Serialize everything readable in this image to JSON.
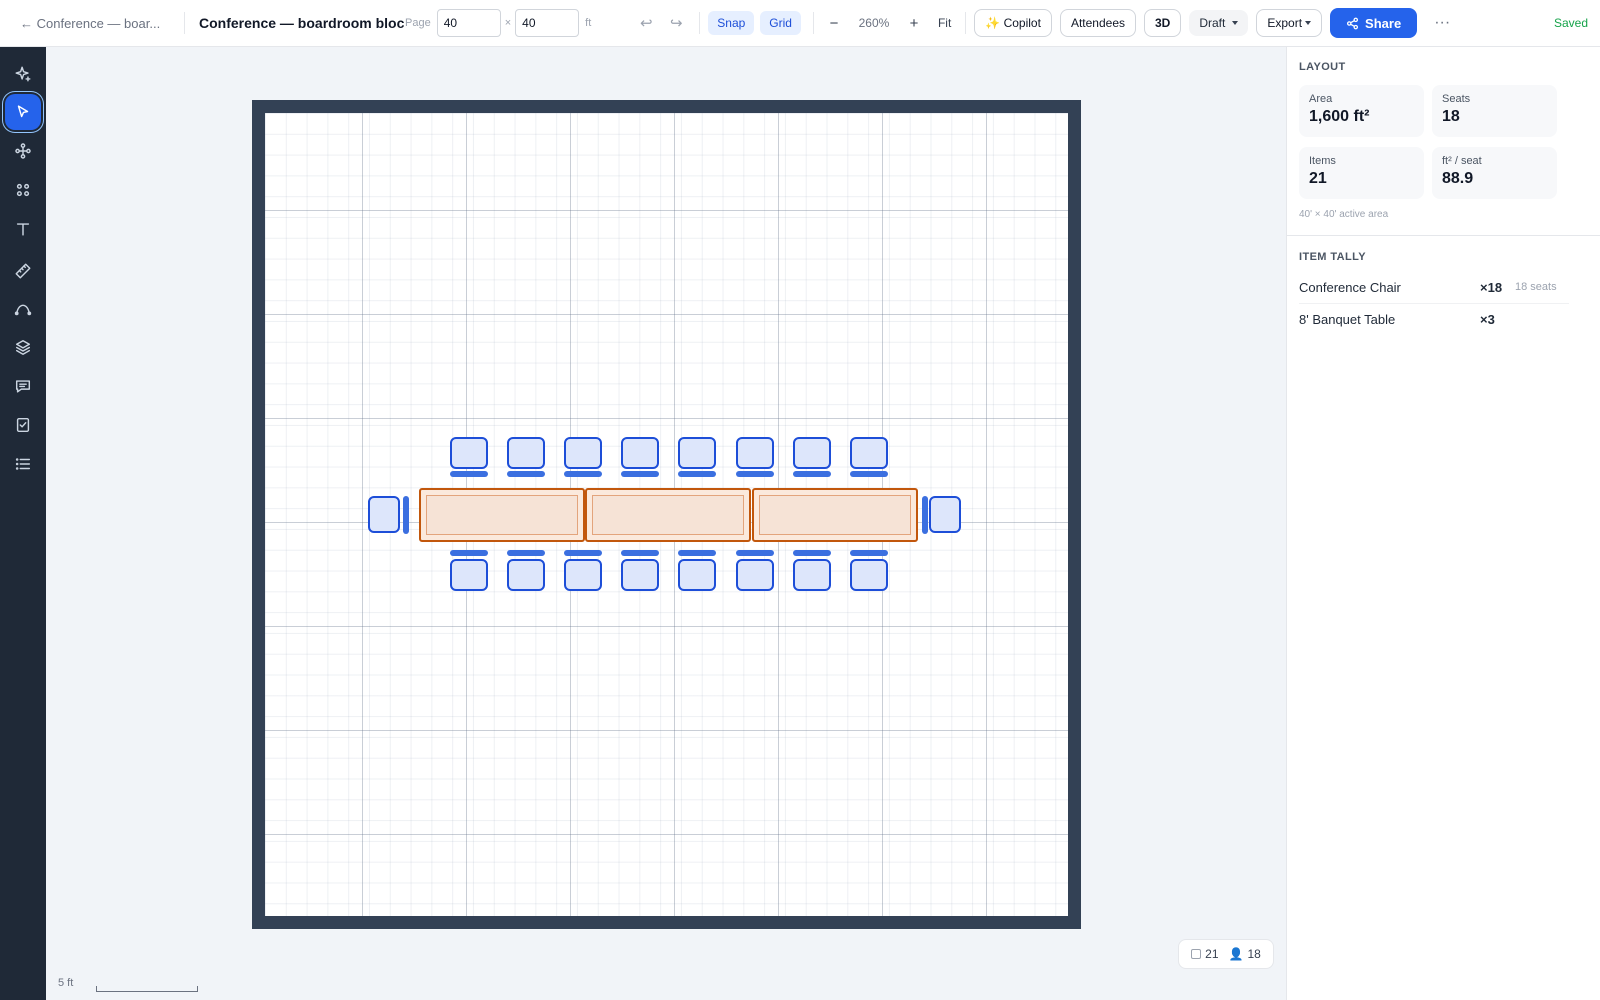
{
  "header": {
    "back_label": "← Conference — boar...",
    "title": "Conference — boardroom block",
    "page_label": "Page",
    "width_value": "40",
    "height_value": "40",
    "times": "×",
    "unit": "ft",
    "snap_label": "Snap",
    "grid_label": "Grid",
    "zoom_out": "−",
    "zoom_level": "260%",
    "zoom_in": "+",
    "fit_label": "Fit",
    "copilot_label": "✨ Copilot",
    "attendees_label": "Attendees",
    "threed_label": "3D",
    "draft_label": "Draft",
    "export_label": "Export",
    "share_label": "Share",
    "more": "···",
    "saved_label": "Saved"
  },
  "toolbar": {
    "tools": [
      "ai-sparkle",
      "select",
      "node",
      "components",
      "text",
      "measure",
      "curve",
      "layers",
      "comments",
      "checklist",
      "list"
    ],
    "active": "select"
  },
  "canvas": {
    "scale_label": "5 ft",
    "status_items": "21",
    "status_seats": "18",
    "colors": {
      "chair": "#1d4ed8",
      "table": "#c2570c",
      "wall": "#334155"
    }
  },
  "layout_panel": {
    "heading": "Layout",
    "stats": [
      {
        "label": "Area",
        "value": "1,600 ft²"
      },
      {
        "label": "Seats",
        "value": "18"
      },
      {
        "label": "Items",
        "value": "21"
      },
      {
        "label": "ft² / seat",
        "value": "88.9"
      }
    ],
    "note": "40' × 40' active area"
  },
  "tally": {
    "heading": "Item tally",
    "rows": [
      {
        "name": "Conference Chair",
        "count": "×18",
        "sub": "18 seats"
      },
      {
        "name": "8' Banquet Table",
        "count": "×3",
        "sub": ""
      }
    ]
  }
}
